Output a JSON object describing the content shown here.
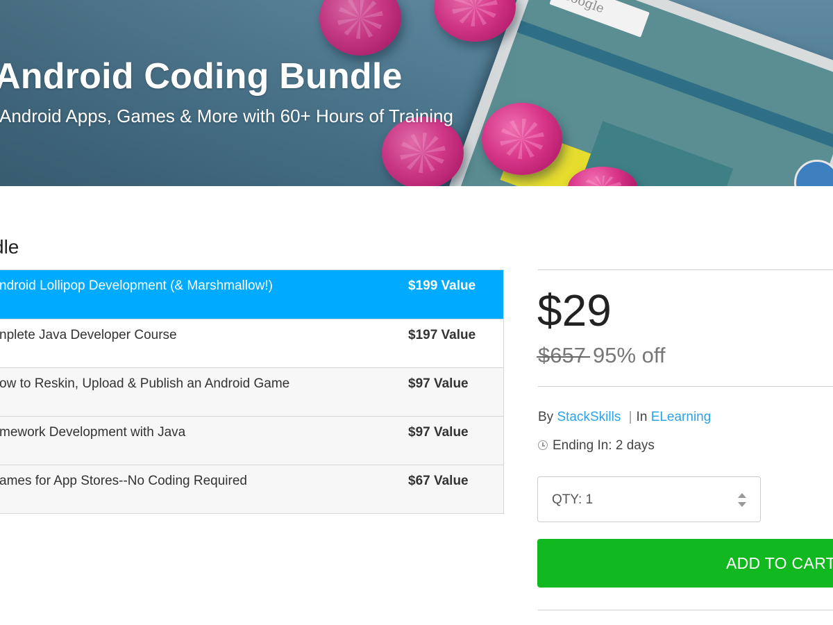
{
  "hero": {
    "title": "Android Coding Bundle",
    "subtitle": "Android Apps, Games & More with 60+ Hours of Training",
    "phone_card_text": "Google"
  },
  "section_heading": "dle",
  "courses": [
    {
      "name": "ndroid Lollipop Development (& Marshmallow!)",
      "value": "$199 Value",
      "active": true
    },
    {
      "name": "nplete Java Developer Course",
      "value": "$197 Value"
    },
    {
      "name": "ow to Reskin, Upload & Publish an Android Game",
      "value": "$97 Value"
    },
    {
      "name": "mework Development with Java",
      "value": "$97 Value"
    },
    {
      "name": "ames for App Stores--No Coding Required",
      "value": "$67 Value"
    }
  ],
  "pricing": {
    "price": "$29",
    "original_price": "$657",
    "discount": "95% off"
  },
  "meta": {
    "by_label": "By",
    "vendor": "StackSkills",
    "separator": "|",
    "in_label": "In",
    "category": "ELearning",
    "ending_label": "Ending In: 2 days"
  },
  "quantity": {
    "label": "QTY: 1"
  },
  "cart": {
    "button_label": "ADD TO CART"
  },
  "colors": {
    "accent_blue": "#00aaff",
    "link_blue": "#2aa3e8",
    "cart_green": "#12b81f"
  }
}
